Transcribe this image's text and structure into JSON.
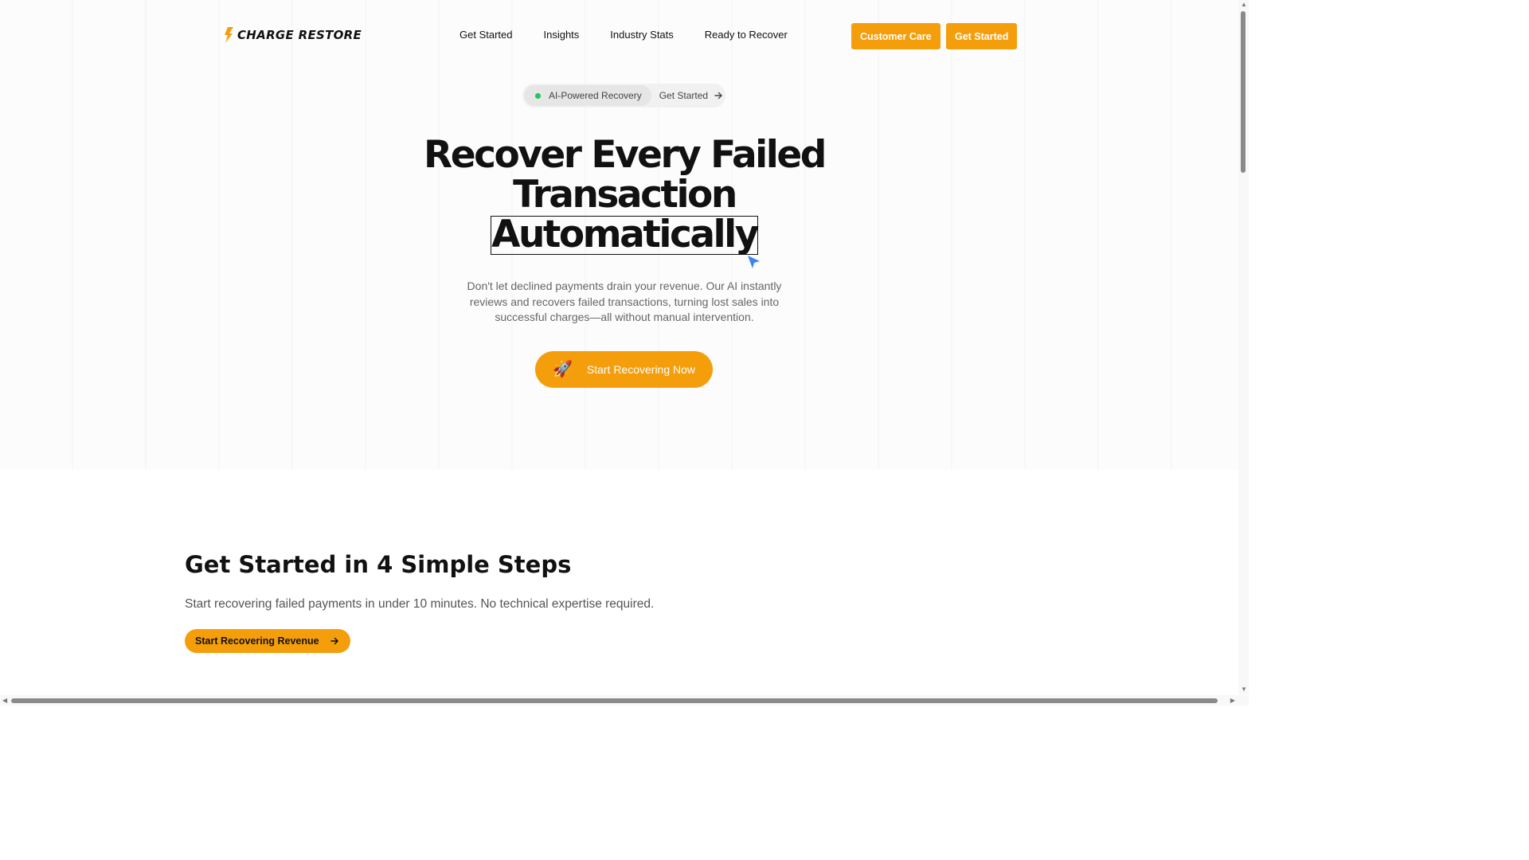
{
  "brand": {
    "name": "CHARGE RESTORE",
    "accent": "#f59e0b"
  },
  "nav": {
    "links": [
      "Get Started",
      "Insights",
      "Industry Stats",
      "Ready to Recover"
    ],
    "customer_care": "Customer Care",
    "get_started": "Get Started"
  },
  "badge": {
    "label": "AI-Powered Recovery",
    "link": "Get Started",
    "dot_color": "#22c55e"
  },
  "hero": {
    "title_line1": "Recover Every Failed",
    "title_line2": "Transaction",
    "title_highlight": "Automatically",
    "subtitle": "Don't let declined payments drain your revenue. Our AI instantly reviews and recovers failed transactions, turning lost sales into successful charges—all without manual intervention.",
    "cta_icon": "rocket-icon",
    "cta_label": "Start Recovering Now"
  },
  "steps": {
    "title": "Get Started in 4 Simple Steps",
    "subtitle": "Start recovering failed payments in under 10 minutes. No technical expertise required.",
    "button_label": "Start Recovering Revenue"
  }
}
